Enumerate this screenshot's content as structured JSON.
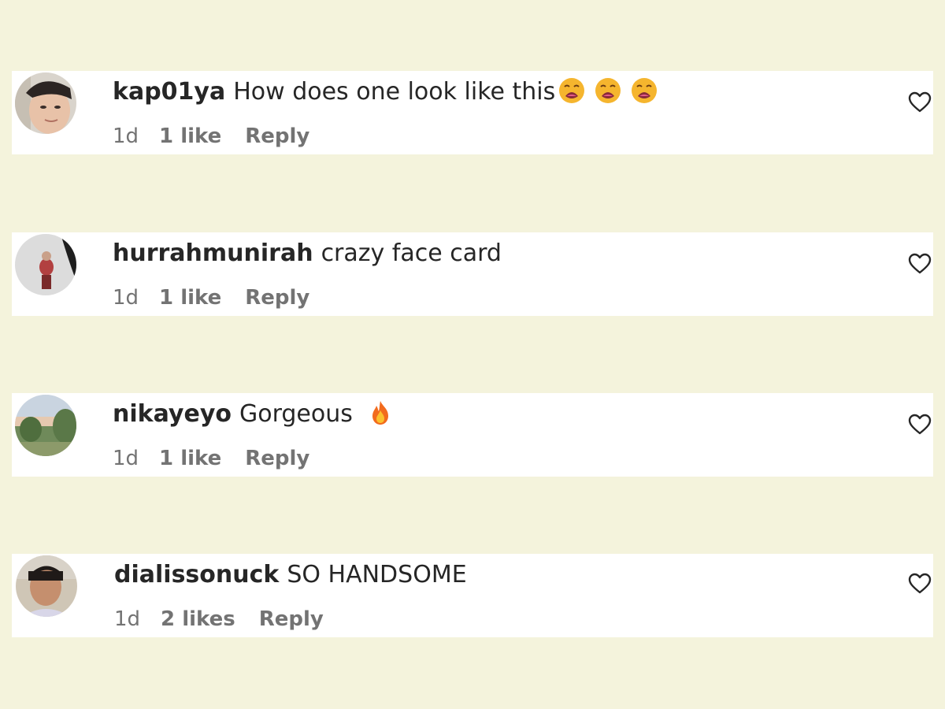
{
  "comments": [
    {
      "username": "kap01ya",
      "text": "How does one look like this",
      "emojis": [
        "weary-face-icon",
        "weary-face-icon",
        "weary-face-icon"
      ],
      "time": "1d",
      "likes": "1 like",
      "reply": "Reply"
    },
    {
      "username": "hurrahmunirah",
      "text": "crazy face card",
      "emojis": [],
      "time": "1d",
      "likes": "1 like",
      "reply": "Reply"
    },
    {
      "username": "nikayeyo",
      "text": "Gorgeous",
      "emojis": [
        "fire-icon"
      ],
      "time": "1d",
      "likes": "1 like",
      "reply": "Reply"
    },
    {
      "username": "dialissonuck",
      "text": "SO HANDSOME",
      "emojis": [],
      "time": "1d",
      "likes": "2 likes",
      "reply": "Reply"
    }
  ],
  "colors": {
    "background": "#f4f3dc",
    "card": "#ffffff",
    "text": "#262626",
    "meta": "#737373"
  }
}
